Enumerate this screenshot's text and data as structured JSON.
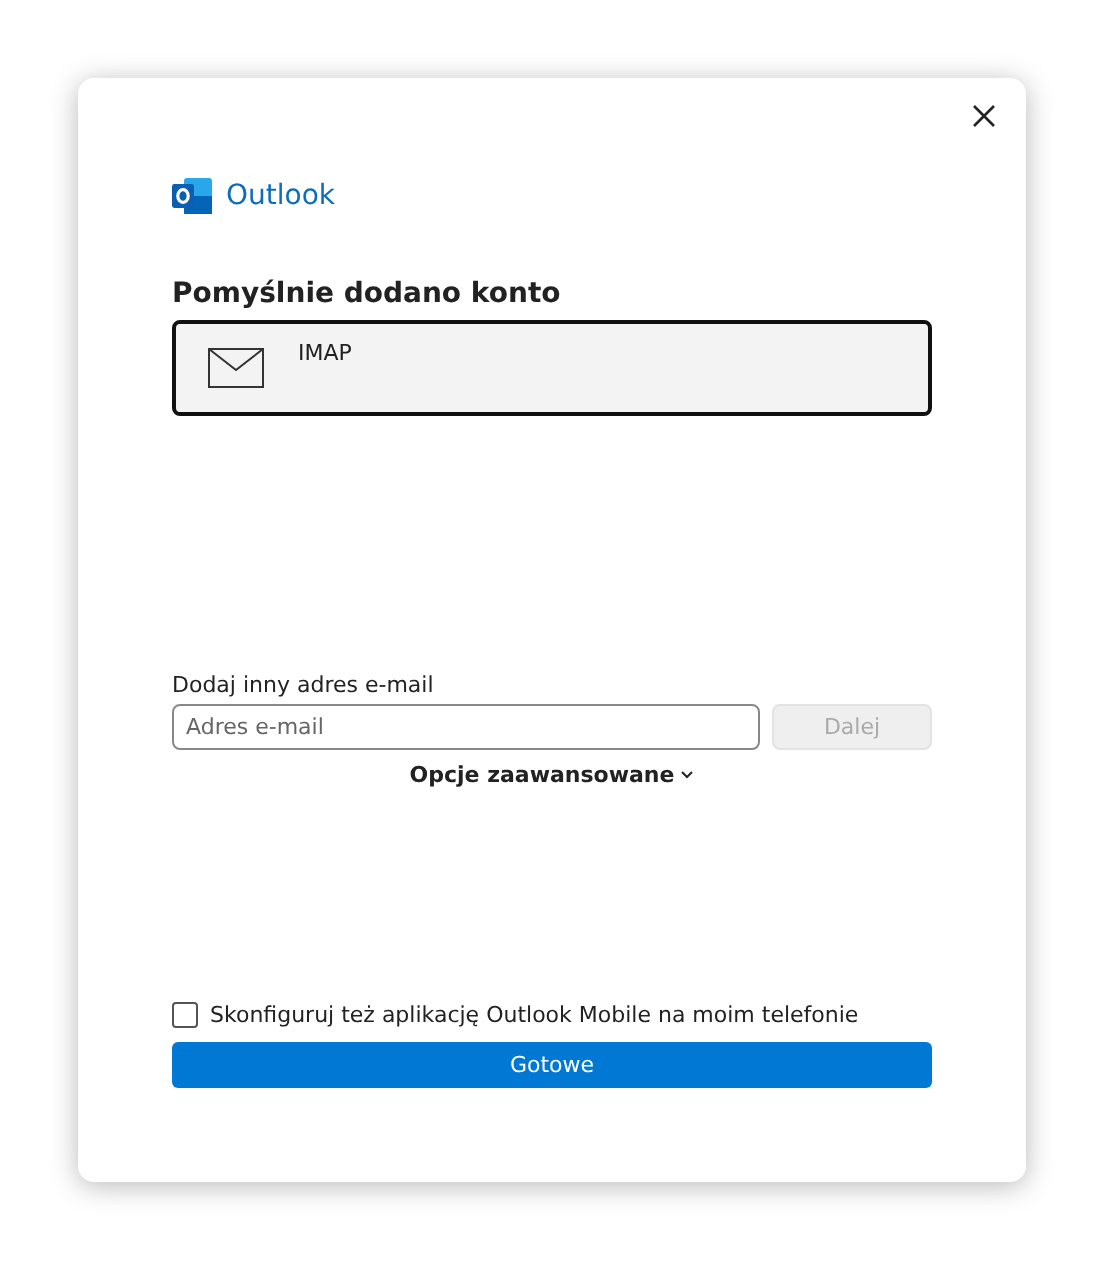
{
  "app": {
    "name": "Outlook"
  },
  "heading": "Pomyślnie dodano konto",
  "accounts": [
    {
      "type": "IMAP",
      "selected": true
    }
  ],
  "add_email": {
    "label": "Dodaj inny adres e-mail",
    "placeholder": "Adres e-mail",
    "button": {
      "label": "Dalej",
      "disabled": true
    }
  },
  "advanced_link": "Opcje zaawansowane",
  "mobile_option": {
    "label": "Skonfiguruj też aplikację Outlook Mobile na moim telefonie",
    "checked": false
  },
  "done_button": "Gotowe"
}
